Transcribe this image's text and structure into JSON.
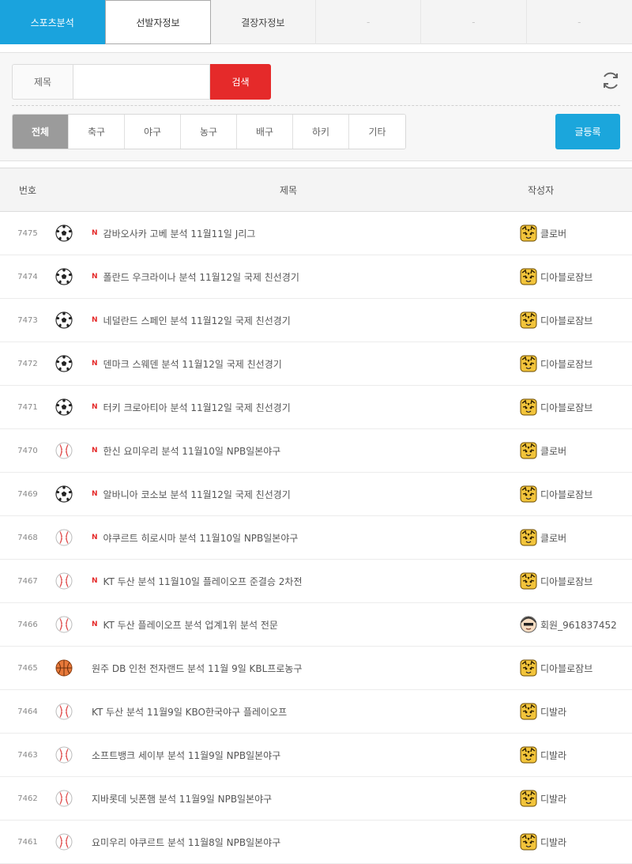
{
  "tabs": [
    {
      "label": "스포츠분석",
      "state": "active"
    },
    {
      "label": "선발자정보",
      "state": "white"
    },
    {
      "label": "결장자정보",
      "state": "normal"
    },
    {
      "label": "-",
      "state": "placeholder"
    },
    {
      "label": "-",
      "state": "placeholder"
    },
    {
      "label": "-",
      "state": "placeholder"
    }
  ],
  "search": {
    "label": "제목",
    "value": "",
    "button": "검색"
  },
  "categories": [
    "전체",
    "축구",
    "야구",
    "농구",
    "배구",
    "하키",
    "기타"
  ],
  "write_button": "글등록",
  "table": {
    "headers": {
      "num": "번호",
      "title": "제목",
      "author": "작성자"
    },
    "rows": [
      {
        "num": "7475",
        "sport": "soccer",
        "new": true,
        "title": "감바오사카 고베 분석 11월11일 J리그",
        "avatar": "tiger",
        "author": "클로버"
      },
      {
        "num": "7474",
        "sport": "soccer",
        "new": true,
        "title": "폴란드 우크라이나 분석 11월12일 국제 친선경기",
        "avatar": "tiger",
        "author": "디아블로잠브"
      },
      {
        "num": "7473",
        "sport": "soccer",
        "new": true,
        "title": "네덜란드 스페인 분석 11월12일 국제 친선경기",
        "avatar": "tiger",
        "author": "디아블로잠브"
      },
      {
        "num": "7472",
        "sport": "soccer",
        "new": true,
        "title": "덴마크 스웨덴 분석 11월12일 국제 친선경기",
        "avatar": "tiger",
        "author": "디아블로잠브"
      },
      {
        "num": "7471",
        "sport": "soccer",
        "new": true,
        "title": "터키 크로아티아 분석 11월12일 국제 친선경기",
        "avatar": "tiger",
        "author": "디아블로잠브"
      },
      {
        "num": "7470",
        "sport": "baseball",
        "new": true,
        "title": "한신 요미우리 분석 11월10일 NPB일본야구",
        "avatar": "tiger",
        "author": "클로버"
      },
      {
        "num": "7469",
        "sport": "soccer",
        "new": true,
        "title": "알바니아 코소보 분석 11월12일 국제 친선경기",
        "avatar": "tiger",
        "author": "디아블로잠브"
      },
      {
        "num": "7468",
        "sport": "baseball",
        "new": true,
        "title": "야쿠르트 히로시마 분석 11월10일 NPB일본야구",
        "avatar": "tiger",
        "author": "클로버"
      },
      {
        "num": "7467",
        "sport": "baseball",
        "new": true,
        "title": "KT 두산 분석 11월10일 플레이오프 준결승 2차전",
        "avatar": "tiger",
        "author": "디아블로잠브"
      },
      {
        "num": "7466",
        "sport": "baseball",
        "new": true,
        "title": "KT 두산 플레이오프 분석 업계1위 분석 전문",
        "avatar": "member",
        "author": "회원_961837452"
      },
      {
        "num": "7465",
        "sport": "basketball",
        "new": false,
        "title": "원주 DB 인천 전자랜드 분석 11월 9일 KBL프로농구",
        "avatar": "tiger",
        "author": "디아블로잠브"
      },
      {
        "num": "7464",
        "sport": "baseball",
        "new": false,
        "title": "KT 두산 분석 11월9일 KBO한국야구 플레이오프",
        "avatar": "tiger",
        "author": "디발라"
      },
      {
        "num": "7463",
        "sport": "baseball",
        "new": false,
        "title": "소프트뱅크 세이부 분석 11월9일 NPB일본야구",
        "avatar": "tiger",
        "author": "디발라"
      },
      {
        "num": "7462",
        "sport": "baseball",
        "new": false,
        "title": "지바롯데 닛폰햄 분석 11월9일 NPB일본야구",
        "avatar": "tiger",
        "author": "디발라"
      },
      {
        "num": "7461",
        "sport": "baseball",
        "new": false,
        "title": "요미우리 야쿠르트 분석 11월8일 NPB일본야구",
        "avatar": "tiger",
        "author": "디발라"
      }
    ]
  },
  "new_badge": "N",
  "colors": {
    "accent": "#1aa3dd",
    "search_red": "#e52a2a",
    "new_red": "#e52a2a"
  }
}
